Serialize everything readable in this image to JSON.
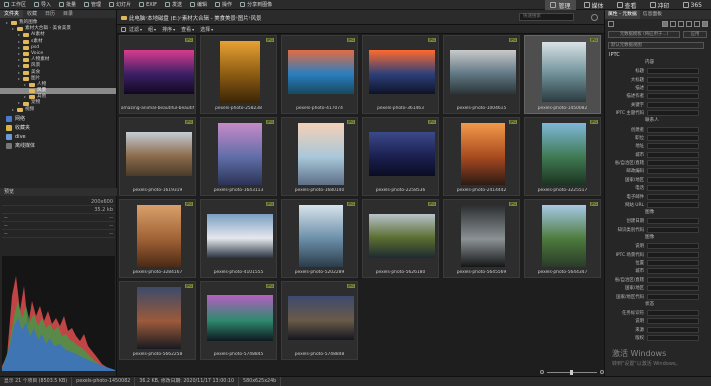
{
  "menubar": {
    "items": [
      {
        "label": "工作区",
        "icon": "workspace-icon"
      },
      {
        "label": "导入",
        "icon": "import-icon"
      },
      {
        "label": "批量",
        "icon": "batch-icon"
      },
      {
        "label": "管理",
        "icon": "manage-icon"
      },
      {
        "label": "幻灯片",
        "icon": "slideshow-icon"
      },
      {
        "label": "EXIF",
        "icon": "exif-icon"
      },
      {
        "label": "发送",
        "icon": "send-icon"
      },
      {
        "label": "编辑",
        "icon": "edit-icon"
      },
      {
        "label": "操作",
        "icon": "operate-icon"
      },
      {
        "label": "分享到图像",
        "icon": "share-icon"
      }
    ],
    "modes": [
      {
        "label": "管理",
        "active": true
      },
      {
        "label": "媒体",
        "active": false
      },
      {
        "label": "查看",
        "active": false
      },
      {
        "label": "冲印",
        "active": false
      },
      {
        "label": "365",
        "active": false
      }
    ]
  },
  "leftpanel": {
    "tabs": [
      "文件夹",
      "收藏",
      "日历",
      "目录"
    ],
    "tree": [
      {
        "label": "我的图像",
        "depth": 1,
        "selected": false
      },
      {
        "label": "素材大合辑 - 美食美景",
        "depth": 2,
        "selected": false
      },
      {
        "label": "AI素材",
        "depth": 3,
        "selected": false
      },
      {
        "label": "s素材",
        "depth": 3,
        "selected": false
      },
      {
        "label": "psd",
        "depth": 3,
        "selected": false
      },
      {
        "label": "Voice",
        "depth": 3,
        "selected": false
      },
      {
        "label": "人物素材",
        "depth": 3,
        "selected": false
      },
      {
        "label": "风景",
        "depth": 3,
        "selected": false
      },
      {
        "label": "美食",
        "depth": 3,
        "selected": false
      },
      {
        "label": "图片",
        "depth": 3,
        "selected": false
      },
      {
        "label": "人物",
        "depth": 4,
        "selected": false
      },
      {
        "label": "风景",
        "depth": 4,
        "selected": true
      },
      {
        "label": "其他",
        "depth": 4,
        "selected": false
      },
      {
        "label": "宠物",
        "depth": 3,
        "selected": false
      },
      {
        "label": "视频",
        "depth": 2,
        "selected": false
      }
    ],
    "specials": [
      {
        "label": "网络",
        "icon": "network-icon",
        "color": "#4a7bd0"
      },
      {
        "label": "收藏夹",
        "icon": "favorites-icon",
        "color": "#d8b440"
      },
      {
        "label": "dive",
        "icon": "cloud-icon",
        "color": "#6a9bd8"
      },
      {
        "label": "离线媒体",
        "icon": "offline-media-icon",
        "color": "#777777"
      }
    ],
    "preview_title": "预览",
    "exif": [
      {
        "left": "",
        "right": "200x600"
      },
      {
        "left": "",
        "right": "35.2 kb"
      },
      {
        "left": "--",
        "right": "--"
      },
      {
        "left": "--",
        "right": "--"
      },
      {
        "left": "--",
        "right": "--"
      }
    ]
  },
  "navbar": {
    "crumbs": [
      "此电脑",
      "本地磁盘 (E:)",
      "素材大合辑 - 美食美景",
      "图片",
      "风景"
    ],
    "search_placeholder": "快速搜索"
  },
  "filterbar": {
    "items": [
      "过滤",
      "组",
      "排序",
      "查看",
      "选择"
    ]
  },
  "grid": {
    "items": [
      {
        "name": "amazing-animal-beautiful-beautif",
        "badge": "JPG",
        "selected": false,
        "colors": [
          "#d93c8f",
          "#3b1f66",
          "#120820"
        ],
        "w": 70,
        "h": 44
      },
      {
        "name": "pexels-photo-258238",
        "badge": "JPG",
        "selected": false,
        "colors": [
          "#e8a233",
          "#8a5a12",
          "#3a2507"
        ],
        "w": 40,
        "h": 62
      },
      {
        "name": "pexels-photo-417074",
        "badge": "JPG",
        "selected": false,
        "colors": [
          "#e26d42",
          "#2a7ec0",
          "#18485e"
        ],
        "w": 66,
        "h": 44
      },
      {
        "name": "pexels-photo-361463",
        "badge": "JPG",
        "selected": false,
        "colors": [
          "#ff6b2e",
          "#2d3f7a",
          "#0d1328"
        ],
        "w": 66,
        "h": 44
      },
      {
        "name": "pexels-photo-1004615",
        "badge": "JPG",
        "selected": false,
        "colors": [
          "#c9c9c9",
          "#5f7683",
          "#2b3538"
        ],
        "w": 66,
        "h": 44
      },
      {
        "name": "pexels-photo-1450082",
        "badge": "JPG",
        "selected": true,
        "colors": [
          "#d8e2e6",
          "#6d8e96",
          "#2a3b40"
        ],
        "w": 44,
        "h": 60
      },
      {
        "name": "pexels-photo-1619319",
        "badge": "JPG",
        "selected": false,
        "colors": [
          "#c4cdd7",
          "#8b6b4a",
          "#4a3a2a"
        ],
        "w": 66,
        "h": 44
      },
      {
        "name": "pexels-photo-1643113",
        "badge": "JPG",
        "selected": false,
        "colors": [
          "#c78ac9",
          "#5f6ea8",
          "#2c3357"
        ],
        "w": 44,
        "h": 62
      },
      {
        "name": "pexels-photo-1680140",
        "badge": "JPG",
        "selected": false,
        "colors": [
          "#f4d1b8",
          "#a8c7d9",
          "#5d6f87"
        ],
        "w": 46,
        "h": 62
      },
      {
        "name": "pexels-photo-2258536",
        "badge": "JPG",
        "selected": false,
        "colors": [
          "#3b4a8a",
          "#1b2050",
          "#0b0c22"
        ],
        "w": 66,
        "h": 44
      },
      {
        "name": "pexels-photo-2414442",
        "badge": "JPG",
        "selected": false,
        "colors": [
          "#f39a4a",
          "#a84a1f",
          "#2c1a16"
        ],
        "w": 44,
        "h": 62
      },
      {
        "name": "pexels-photo-3225517",
        "badge": "JPG",
        "selected": false,
        "colors": [
          "#7fb7d9",
          "#3f7a52",
          "#1c3322"
        ],
        "w": 44,
        "h": 62
      },
      {
        "name": "pexels-photo-3284167",
        "badge": "JPG",
        "selected": false,
        "colors": [
          "#d9a06b",
          "#a06235",
          "#4a2a16"
        ],
        "w": 44,
        "h": 62
      },
      {
        "name": "pexels-photo-4101555",
        "badge": "JPG",
        "selected": false,
        "colors": [
          "#7a9ec2",
          "#e5e8ee",
          "#2b3340"
        ],
        "w": 66,
        "h": 44
      },
      {
        "name": "pexels-photo-5202289",
        "badge": "JPG",
        "selected": false,
        "colors": [
          "#d7e3ec",
          "#6b8ea8",
          "#2b3c4a"
        ],
        "w": 44,
        "h": 62
      },
      {
        "name": "pexels-photo-5626180",
        "badge": "JPG",
        "selected": false,
        "colors": [
          "#b8c3ca",
          "#5a6d2f",
          "#1d2a32"
        ],
        "w": 66,
        "h": 44
      },
      {
        "name": "pexels-photo-5645569",
        "badge": "JPG",
        "selected": false,
        "colors": [
          "#2a2e30",
          "#8c9295",
          "#141617"
        ],
        "w": 44,
        "h": 62
      },
      {
        "name": "pexels-photo-5644347",
        "badge": "JPG",
        "selected": false,
        "colors": [
          "#a7c9e6",
          "#4c7a3c",
          "#2a3a2a"
        ],
        "w": 44,
        "h": 62
      },
      {
        "name": "pexels-photo-5662258",
        "badge": "JPG",
        "selected": false,
        "colors": [
          "#3c4a6a",
          "#9c5a3a",
          "#181a22"
        ],
        "w": 44,
        "h": 62
      },
      {
        "name": "pexels-photo-5748845",
        "badge": "JPG",
        "selected": false,
        "colors": [
          "#b65fc2",
          "#2f8a6e",
          "#101820"
        ],
        "w": 66,
        "h": 46
      },
      {
        "name": "pexels-photo-5748848",
        "badge": "JPG",
        "selected": false,
        "colors": [
          "#3d4a6e",
          "#6a5a4a",
          "#15171e"
        ],
        "w": 66,
        "h": 44
      }
    ]
  },
  "statusbar": {
    "items": [
      "显示 21 个项目 (8503.5 KB)",
      "pexels-photo-1450082",
      "36.2 KB, 修改日期: 2020/11/17 13:00:10",
      "580x625x24b"
    ]
  },
  "rightpanel": {
    "tabs": [
      "属性 - 元数据",
      "信息面板"
    ],
    "buttons": [
      "元数据模板 (将应用于...)",
      "应用"
    ],
    "default_label": "默认元数据视图",
    "section_iptc": "IPTC",
    "sub_content": "内容",
    "iptc_fields": [
      "标题",
      "大标题",
      "描述",
      "描述作者",
      "关键字",
      "IPTC 主题代码"
    ],
    "sub_contact": "联系人",
    "contact_fields": [
      "创建者",
      "职位",
      "地址",
      "城市",
      "省/自治区/直辖",
      "邮政编码",
      "国家/地区",
      "电话",
      "电子邮件",
      "网站 URL"
    ],
    "sub_image": "图像",
    "image_fields": [
      "创建日期",
      "知识类别代码"
    ],
    "sub_status": "图像",
    "status_fields": [
      "说明",
      "IPTC 场景代码",
      "位置",
      "城市",
      "省/自治区/直辖",
      "国家/地区",
      "国家/地区代码"
    ],
    "sub_state": "状态",
    "state_fields": [
      "任务标识符",
      "说明",
      "来源",
      "版权"
    ]
  },
  "watermark": {
    "line1": "激活 Windows",
    "line2": "转到\"设置\"以激活 Windows。"
  }
}
